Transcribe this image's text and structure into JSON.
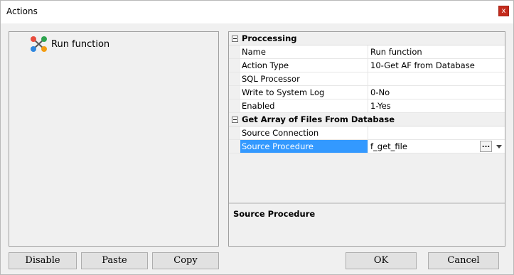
{
  "window": {
    "title": "Actions",
    "close_label": "x"
  },
  "tree": {
    "items": [
      {
        "label": "Run function",
        "icon": "run-function-icon"
      }
    ]
  },
  "grid": {
    "categories": [
      {
        "label": "Proccessing",
        "rows": [
          {
            "name": "Name",
            "value": "Run function"
          },
          {
            "name": "Action Type",
            "value": "10-Get AF from Database"
          },
          {
            "name": "SQL Processor",
            "value": ""
          },
          {
            "name": "Write to System Log",
            "value": "0-No"
          },
          {
            "name": "Enabled",
            "value": "1-Yes"
          }
        ]
      },
      {
        "label": "Get Array of Files From Database",
        "rows": [
          {
            "name": "Source Connection",
            "value": ""
          },
          {
            "name": "Source Procedure",
            "value": "f_get_file",
            "selected": true,
            "ellipsis": "..."
          }
        ]
      }
    ],
    "description_title": "Source Procedure"
  },
  "buttons": {
    "disable": "Disable",
    "paste": "Paste",
    "copy": "Copy",
    "ok": "OK",
    "cancel": "Cancel"
  },
  "colors": {
    "selection": "#3399ff",
    "close": "#c42b1c"
  }
}
